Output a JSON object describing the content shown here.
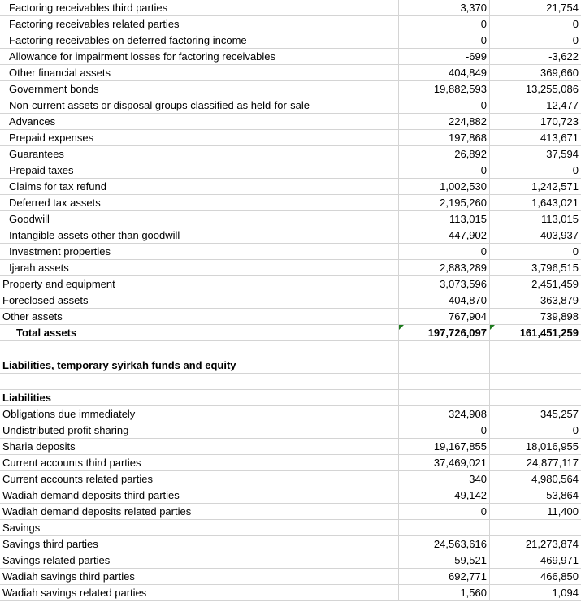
{
  "rows": [
    {
      "label": "Factoring receivables third parties",
      "v1": "3,370",
      "v2": "21,754",
      "style": "indent1"
    },
    {
      "label": "Factoring receivables related parties",
      "v1": "0",
      "v2": "0",
      "style": "indent1"
    },
    {
      "label": "Factoring receivables on deferred factoring income",
      "v1": "0",
      "v2": "0",
      "style": "indent1"
    },
    {
      "label": "Allowance for impairment losses for factoring receivables",
      "v1": "-699",
      "v2": "-3,622",
      "style": "indent1"
    },
    {
      "label": "Other financial assets",
      "v1": "404,849",
      "v2": "369,660",
      "style": "indent1"
    },
    {
      "label": "Government bonds",
      "v1": "19,882,593",
      "v2": "13,255,086",
      "style": "indent1"
    },
    {
      "label": "Non-current assets or disposal groups classified as held-for-sale",
      "v1": "0",
      "v2": "12,477",
      "style": "indent1"
    },
    {
      "label": "Advances",
      "v1": "224,882",
      "v2": "170,723",
      "style": "indent1"
    },
    {
      "label": "Prepaid expenses",
      "v1": "197,868",
      "v2": "413,671",
      "style": "indent1"
    },
    {
      "label": "Guarantees",
      "v1": "26,892",
      "v2": "37,594",
      "style": "indent1"
    },
    {
      "label": "Prepaid taxes",
      "v1": "0",
      "v2": "0",
      "style": "indent1"
    },
    {
      "label": "Claims for tax refund",
      "v1": "1,002,530",
      "v2": "1,242,571",
      "style": "indent1"
    },
    {
      "label": "Deferred tax assets",
      "v1": "2,195,260",
      "v2": "1,643,021",
      "style": "indent1"
    },
    {
      "label": "Goodwill",
      "v1": "113,015",
      "v2": "113,015",
      "style": "indent1"
    },
    {
      "label": "Intangible assets other than goodwill",
      "v1": "447,902",
      "v2": "403,937",
      "style": "indent1"
    },
    {
      "label": "Investment properties",
      "v1": "0",
      "v2": "0",
      "style": "indent1"
    },
    {
      "label": "Ijarah assets",
      "v1": "2,883,289",
      "v2": "3,796,515",
      "style": "indent1"
    },
    {
      "label": "Property and equipment",
      "v1": "3,073,596",
      "v2": "2,451,459",
      "style": ""
    },
    {
      "label": "Foreclosed assets",
      "v1": "404,870",
      "v2": "363,879",
      "style": ""
    },
    {
      "label": "Other assets",
      "v1": "767,904",
      "v2": "739,898",
      "style": ""
    },
    {
      "label": "Total assets",
      "v1": "197,726,097",
      "v2": "161,451,259",
      "style": "indent2 bold",
      "flag": true
    },
    {
      "label": "",
      "v1": "",
      "v2": "",
      "style": ""
    },
    {
      "label": "Liabilities, temporary syirkah funds and equity",
      "v1": "",
      "v2": "",
      "style": "bold"
    },
    {
      "label": "",
      "v1": "",
      "v2": "",
      "style": ""
    },
    {
      "label": "Liabilities",
      "v1": "",
      "v2": "",
      "style": "bold"
    },
    {
      "label": "Obligations due immediately",
      "v1": "324,908",
      "v2": "345,257",
      "style": ""
    },
    {
      "label": "Undistributed profit sharing",
      "v1": "0",
      "v2": "0",
      "style": ""
    },
    {
      "label": "Sharia deposits",
      "v1": "19,167,855",
      "v2": "18,016,955",
      "style": ""
    },
    {
      "label": "Current accounts third parties",
      "v1": "37,469,021",
      "v2": "24,877,117",
      "style": ""
    },
    {
      "label": "Current accounts related parties",
      "v1": "340",
      "v2": "4,980,564",
      "style": ""
    },
    {
      "label": "Wadiah demand deposits third parties",
      "v1": "49,142",
      "v2": "53,864",
      "style": ""
    },
    {
      "label": "Wadiah demand deposits related parties",
      "v1": "0",
      "v2": "11,400",
      "style": ""
    },
    {
      "label": "Savings",
      "v1": "",
      "v2": "",
      "style": ""
    },
    {
      "label": "Savings third parties",
      "v1": "24,563,616",
      "v2": "21,273,874",
      "style": ""
    },
    {
      "label": "Savings related parties",
      "v1": "59,521",
      "v2": "469,971",
      "style": ""
    },
    {
      "label": "Wadiah savings third parties",
      "v1": "692,771",
      "v2": "466,850",
      "style": ""
    },
    {
      "label": "Wadiah savings related parties",
      "v1": "1,560",
      "v2": "1,094",
      "style": ""
    }
  ]
}
